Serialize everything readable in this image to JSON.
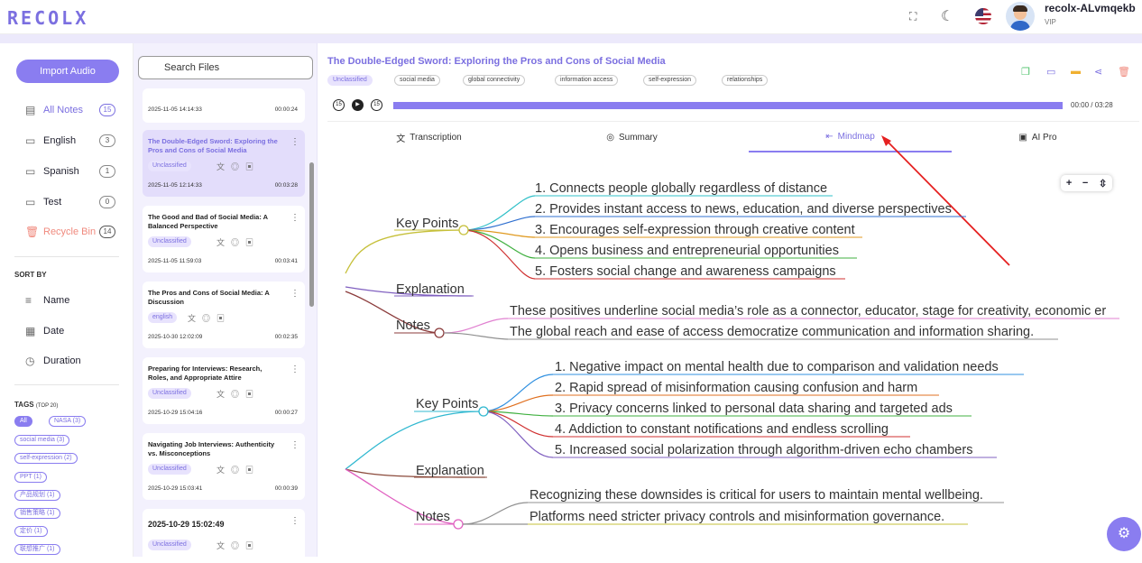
{
  "app": {
    "logo": "RECOLX",
    "user_name": "recolx-ALvmqekb",
    "user_level": "VIP"
  },
  "topbar_icons": [
    "fullscreen-icon",
    "moon-icon",
    "us-flag-icon"
  ],
  "sidebar": {
    "import_label": "Import Audio",
    "nav": [
      {
        "label": "All Notes",
        "count": "15"
      },
      {
        "label": "English",
        "count": "3"
      },
      {
        "label": "Spanish",
        "count": "1"
      },
      {
        "label": "Test",
        "count": "0"
      },
      {
        "label": "Recycle Bin",
        "count": "14"
      }
    ],
    "sort_title": "SORT BY",
    "sort": [
      "Name",
      "Date",
      "Duration"
    ],
    "tags_title": "TAGS",
    "tags_sub": "(TOP 20)",
    "tags": [
      "All",
      "NASA (3)",
      "social media (3)",
      "self-expression (2)",
      "PPT (1)",
      "产品规划 (1)",
      "销售策略 (1)",
      "定价 (1)",
      "联想推广 (1)"
    ]
  },
  "filelist": {
    "search_placeholder": "Search Files",
    "cards": [
      {
        "title": "",
        "tag": "",
        "date": "2025-11-05 14:14:33",
        "duration": "00:00:24"
      },
      {
        "title": "The Double-Edged Sword: Exploring the Pros and Cons of Social Media",
        "tag": "Unclassified",
        "date": "2025-11-05 12:14:33",
        "duration": "00:03:28"
      },
      {
        "title": "The Good and Bad of Social Media: A Balanced Perspective",
        "tag": "Unclassified",
        "date": "2025-11-05 11:59:03",
        "duration": "00:03:41"
      },
      {
        "title": "The Pros and Cons of Social Media: A Discussion",
        "tag": "english",
        "date": "2025-10-30 12:02:09",
        "duration": "00:02:35"
      },
      {
        "title": "Preparing for Interviews: Research, Roles, and Appropriate Attire",
        "tag": "Unclassified",
        "date": "2025-10-29 15:04:16",
        "duration": "00:00:27"
      },
      {
        "title": "Navigating Job Interviews: Authenticity vs. Misconceptions",
        "tag": "Unclassified",
        "date": "2025-10-29 15:03:41",
        "duration": "00:00:39"
      },
      {
        "title": "2025-10-29 15:02:49",
        "tag": "Unclassified",
        "date": "",
        "duration": ""
      }
    ]
  },
  "doc": {
    "title": "The Double-Edged Sword: Exploring the Pros and Cons of Social Media",
    "category": "Unclassified",
    "tags": [
      "social media",
      "global connectivity",
      "information access",
      "self-expression",
      "relationships"
    ],
    "time": "00:00 / 03:28",
    "progress_fraction": 1.0,
    "accent": "#8a7df0"
  },
  "tabs": [
    "Transcription",
    "Summary",
    "Mindmap",
    "AI Pro"
  ],
  "active_tab": "Mindmap",
  "zoom": {
    "plus": "+",
    "minus": "−",
    "fit": "⇳"
  },
  "mindmap": {
    "pros": {
      "key_points_label": "Key Points",
      "points": [
        "1. Connects people globally regardless of distance",
        "2. Provides instant access to news, education, and diverse perspectives",
        "3. Encourages self-expression through creative content",
        "4. Opens business and entrepreneurial opportunities",
        "5. Fosters social change and awareness campaigns"
      ],
      "explanation_label": "Explanation",
      "notes_label": "Notes",
      "notes": [
        "These positives underline social media’s role as a connector, educator, stage for creativity, economic er",
        "The global reach and ease of access democratize communication and information sharing."
      ]
    },
    "cons": {
      "key_points_label": "Key Points",
      "points": [
        "1. Negative impact on mental health due to comparison and validation needs",
        "2. Rapid spread of misinformation causing confusion and harm",
        "3. Privacy concerns linked to personal data sharing and targeted ads",
        "4. Addiction to constant notifications and endless scrolling",
        "5. Increased social polarization through algorithm-driven echo chambers"
      ],
      "explanation_label": "Explanation",
      "notes_label": "Notes",
      "notes": [
        "Recognizing these downsides is critical for users to maintain mental wellbeing.",
        "Platforms need stricter privacy controls and misinformation governance."
      ]
    }
  }
}
